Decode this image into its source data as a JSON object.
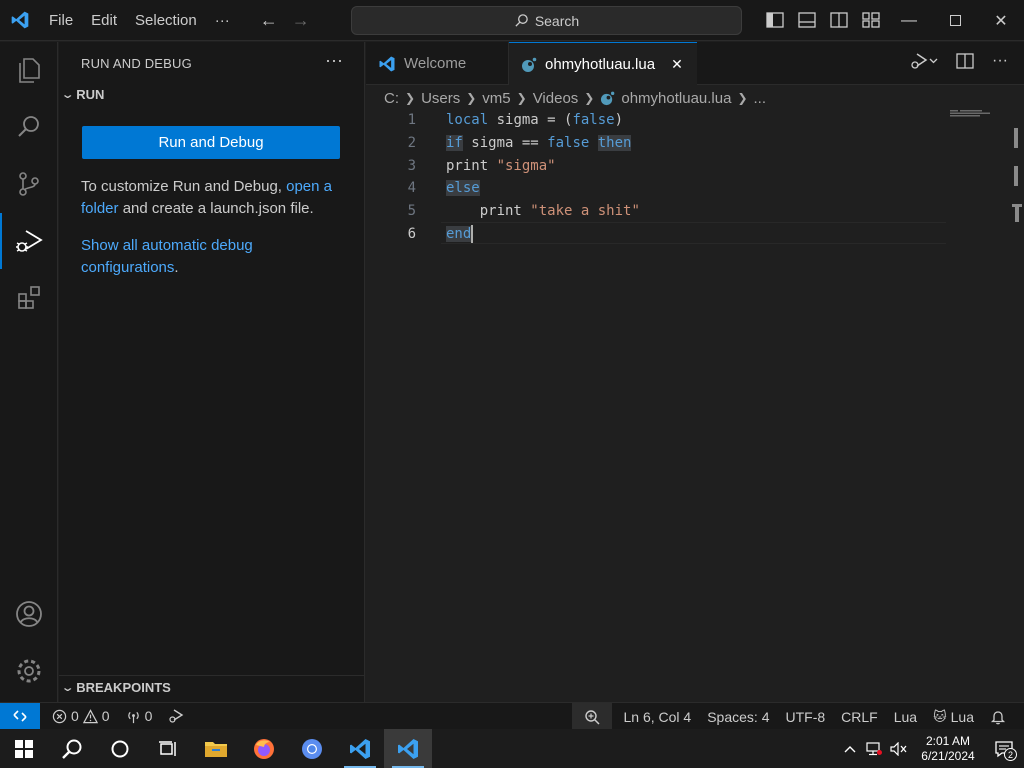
{
  "menu": {
    "file": "File",
    "edit": "Edit",
    "selection": "Selection",
    "more": "···"
  },
  "search": {
    "label": "Search"
  },
  "sidebar": {
    "title": "RUN AND DEBUG",
    "more": "···",
    "run_section": "RUN",
    "run_button": "Run and Debug",
    "customize_text_1": "To customize Run and Debug,",
    "customize_link": "open a folder",
    "customize_text_2": "and create a launch.json file.",
    "show_all_link": "Show all automatic debug configurations",
    "show_all_suffix": ".",
    "breakpoints_section": "BREAKPOINTS"
  },
  "tabs": [
    {
      "label": "Welcome"
    },
    {
      "label": "ohmyhotluau.lua",
      "close": "✕"
    }
  ],
  "breadcrumb": [
    "C:",
    "Users",
    "vm5",
    "Videos",
    "ohmyhotluau.lua",
    "..."
  ],
  "code": {
    "line_numbers": [
      "1",
      "2",
      "3",
      "4",
      "5",
      "6"
    ],
    "l1": {
      "kw": "local",
      "rest1": " sigma = (",
      "kw2": "false",
      "rest2": ")"
    },
    "l2": {
      "kw": "if",
      "rest1": " sigma == ",
      "kw2": "false",
      "rest2": " ",
      "kw3": "then"
    },
    "l3": {
      "rest": "print ",
      "str": "\"sigma\""
    },
    "l4": {
      "kw": "else"
    },
    "l5": {
      "rest": "    print ",
      "str": "\"take a shit\""
    },
    "l6": {
      "kw": "end"
    }
  },
  "status": {
    "errors": "0",
    "warnings": "0",
    "ports": "0",
    "position": "Ln 6, Col 4",
    "spaces": "Spaces: 4",
    "encoding": "UTF-8",
    "eol": "CRLF",
    "language": "Lua",
    "lua_ext": "Lua"
  },
  "taskbar": {
    "time": "2:01 AM",
    "date": "6/21/2024",
    "notifications": "2"
  },
  "colors": {
    "accent": "#0078d4",
    "link": "#4daafc",
    "keyword": "#569cd6",
    "string": "#ce9178"
  }
}
